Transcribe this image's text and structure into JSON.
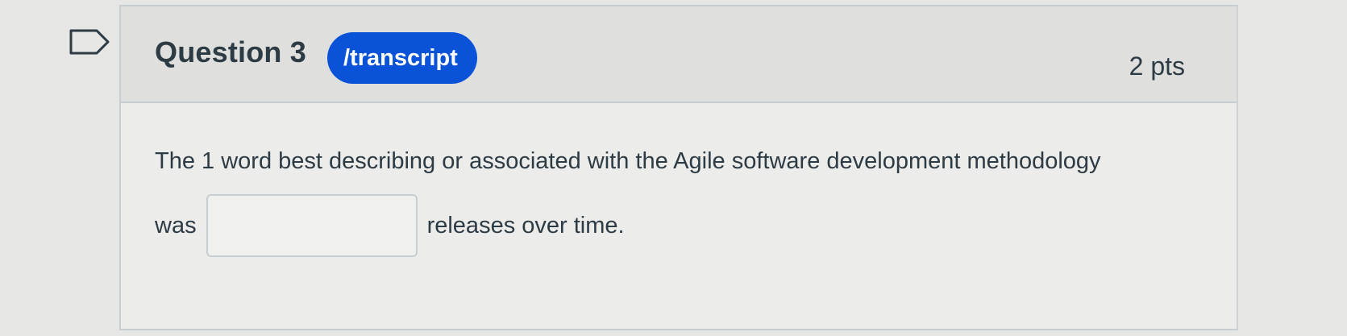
{
  "question": {
    "title": "Question 3",
    "badge": "/transcript",
    "points": "2 pts",
    "text_line1": "The 1 word best describing or associated with the Agile software development methodology",
    "text_before_blank": "was",
    "blank_value": "",
    "text_after_blank": "releases over time."
  },
  "icons": {
    "flag": "flag-outline-icon"
  },
  "colors": {
    "badge": "#0a53d8",
    "text": "#2d3b45"
  }
}
